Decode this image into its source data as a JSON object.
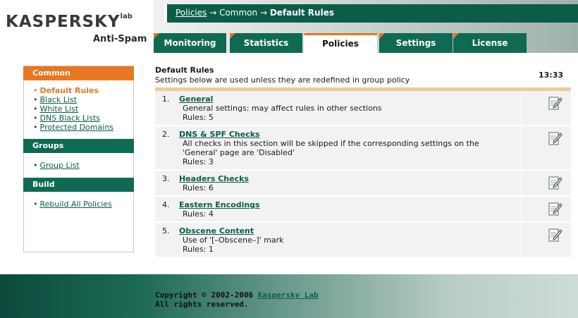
{
  "header": {
    "logo_text": "KASPERSKY",
    "logo_lab": "lab",
    "product_name": "Anti-Spam",
    "breadcrumb": {
      "link": "Policies",
      "separator_1": " → ",
      "middle": "Common",
      "separator_2": " → ",
      "current": "Default Rules"
    }
  },
  "tabs": [
    {
      "label": "Monitoring",
      "active": false
    },
    {
      "label": "Statistics",
      "active": false
    },
    {
      "label": "Policies",
      "active": true
    },
    {
      "label": "Settings",
      "active": false
    },
    {
      "label": "License",
      "active": false
    }
  ],
  "sidebar": {
    "sections": [
      {
        "heading": "Common",
        "items": [
          {
            "label": "Default Rules",
            "current": true
          },
          {
            "label": "Black List",
            "current": false
          },
          {
            "label": "White List",
            "current": false
          },
          {
            "label": "DNS Black Lists",
            "current": false
          },
          {
            "label": "Protected Domains",
            "current": false
          }
        ]
      },
      {
        "heading": "Groups",
        "items": [
          {
            "label": "Group List",
            "current": false
          }
        ]
      },
      {
        "heading": "Build",
        "items": [
          {
            "label": "Rebuild All Policies",
            "current": false
          }
        ]
      }
    ],
    "bullet": "•"
  },
  "content": {
    "title": "Default Rules",
    "subtitle": "Settings below are used unless they are redefined in group policy",
    "clock": "13:33",
    "rules": [
      {
        "num": "1.",
        "name": "General",
        "description": "General settings: may affect rules in other sections",
        "count": "Rules: 5"
      },
      {
        "num": "2.",
        "name": "DNS & SPF Checks",
        "description": "All checks in this section will be skipped if the corresponding settings on the 'General' page are 'Disabled'",
        "count": "Rules: 3"
      },
      {
        "num": "3.",
        "name": "Headers Checks",
        "description": "",
        "count": "Rules: 6"
      },
      {
        "num": "4.",
        "name": "Eastern Encodings",
        "description": "",
        "count": "Rules: 4"
      },
      {
        "num": "5.",
        "name": "Obscene Content",
        "description": "Use of '[–Obscene–]' mark",
        "count": "Rules: 1"
      }
    ],
    "edit_icon": "edit-icon"
  },
  "footer": {
    "copyright": "Copyright © 2002-2006 ",
    "company_link": "Kaspersky Lab",
    "rights": "All rights reserved."
  },
  "colors": {
    "brand_green": "#0b5d4a",
    "tab_green": "#0f6a53",
    "accent_orange": "#e87722"
  }
}
